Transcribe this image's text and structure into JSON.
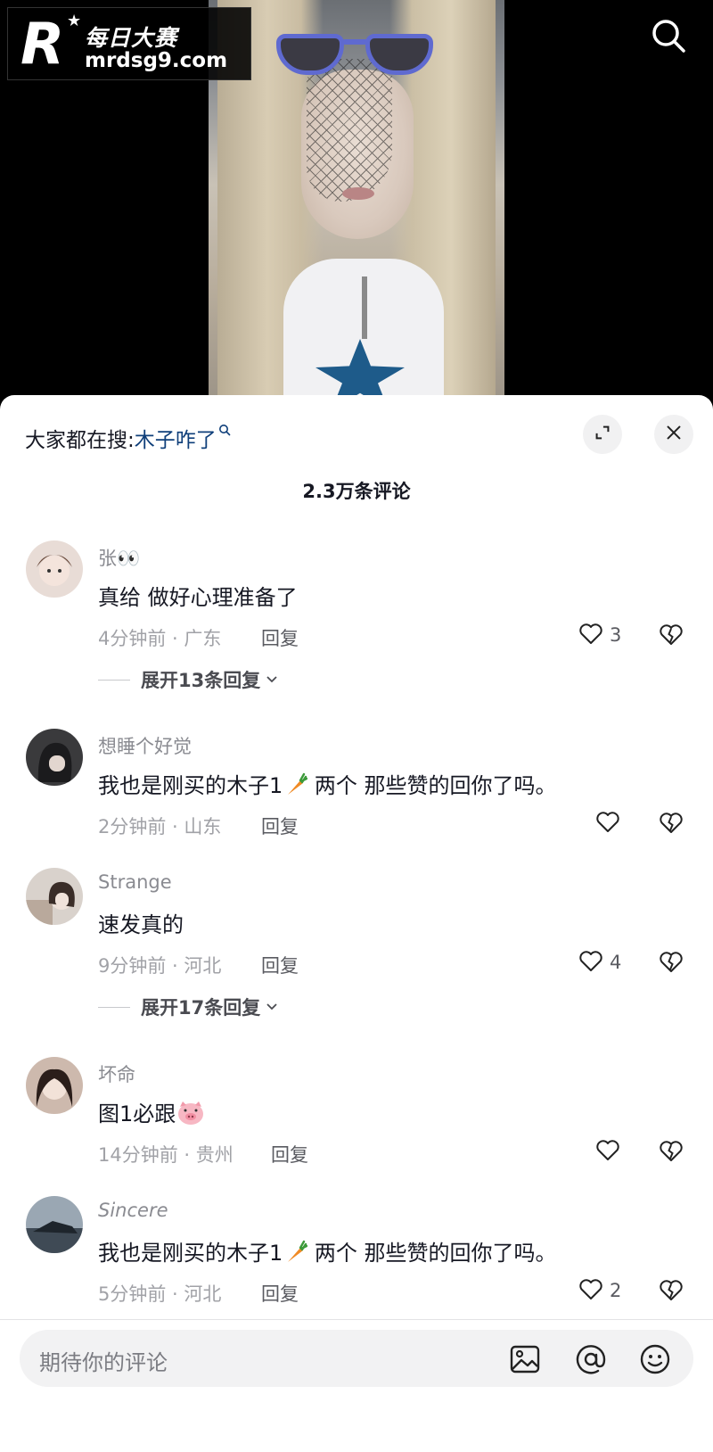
{
  "watermark": {
    "letter": "R",
    "name": "每日大赛",
    "url": "mrdsg9.com"
  },
  "top_bar": {
    "search_icon": "search-icon"
  },
  "sheet": {
    "trending_prefix": "大家都在搜:",
    "trending_keyword": "木子咋了",
    "comment_count": "2.3万条评论"
  },
  "comments": [
    {
      "user": "张👀",
      "text": "真给 做好心理准备了",
      "time_location": "4分钟前 · 广东",
      "reply_label": "回复",
      "likes": "3",
      "expand": "展开13条回复"
    },
    {
      "user": "想睡个好觉",
      "text_before": "我也是刚买的木子1",
      "text_after": " 两个 那些赞的回你了吗。",
      "time_location": "2分钟前 · 山东",
      "reply_label": "回复",
      "likes": ""
    },
    {
      "user": "Strange",
      "text": "速发真的",
      "time_location": "9分钟前 · 河北",
      "reply_label": "回复",
      "likes": "4",
      "expand": "展开17条回复"
    },
    {
      "user": "坏命",
      "text": "图1必跟",
      "time_location": "14分钟前 · 贵州",
      "reply_label": "回复",
      "likes": ""
    },
    {
      "user": "Sincere",
      "text_before": "我也是刚买的木子1",
      "text_after": " 两个 那些赞的回你了吗。",
      "time_location": "5分钟前 · 河北",
      "reply_label": "回复",
      "likes": "2"
    }
  ],
  "input": {
    "placeholder": "期待你的评论",
    "icons": [
      "image-icon",
      "at-icon",
      "emoji-icon"
    ]
  },
  "colors": {
    "keyword": "#0f3f7a",
    "muted": "#a1a2a7",
    "text": "#161823"
  }
}
